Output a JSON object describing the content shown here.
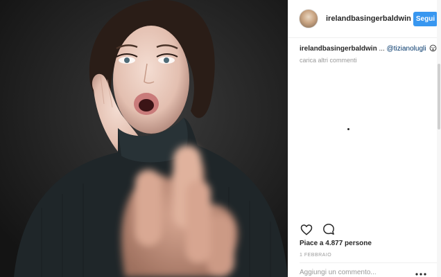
{
  "post": {
    "username": "irelandbasingerbaldwin",
    "follow_label": "Segui"
  },
  "caption": {
    "username": "irelandbasingerbaldwin",
    "more": "...",
    "mention": "@tizianolugli"
  },
  "comments": {
    "load_more": "carica altri commenti"
  },
  "engagement": {
    "likes_text": "Piace a 4.877 persone",
    "date": "1 FEBBRAIO"
  },
  "comment_input": {
    "placeholder": "Aggiungi un commento..."
  },
  "icons": {
    "avatar": "profile-avatar",
    "like": "heart-icon",
    "comment": "comment-bubble-icon",
    "caption_emoji": "face-icon",
    "more": "more-options-icon",
    "loading": "loading-dot"
  },
  "colors": {
    "accent": "#3897f0",
    "mention": "#003569",
    "muted": "#999999",
    "text": "#262626"
  }
}
